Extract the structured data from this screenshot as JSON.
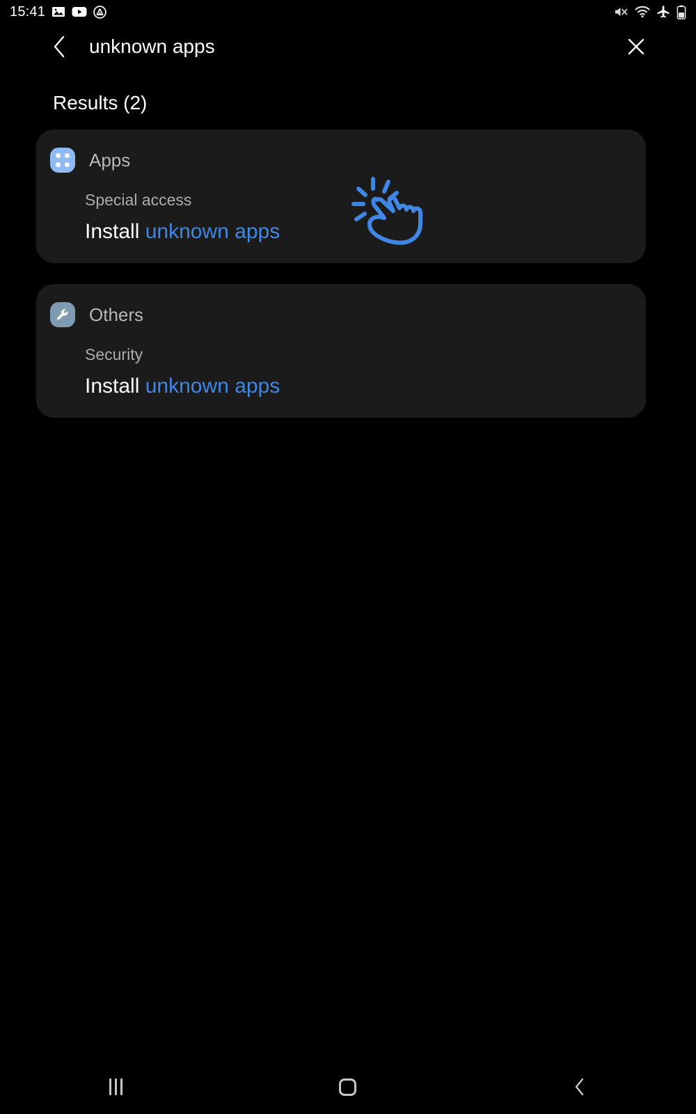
{
  "statusbar": {
    "time": "15:41",
    "left_icons": [
      "image-icon",
      "youtube-icon",
      "drive-triangle-icon"
    ],
    "right_icons": [
      "mute-icon",
      "wifi-icon",
      "airplane-mode-icon",
      "battery-icon"
    ]
  },
  "header": {
    "back_icon": "chevron-left-icon",
    "query": "unknown apps",
    "clear_icon": "close-icon"
  },
  "results": {
    "title": "Results (2)",
    "count": 2,
    "cards": [
      {
        "category": "Apps",
        "category_icon": "apps-grid-icon",
        "icon_color": "#8fbaf5",
        "sub_label": "Special access",
        "main_prefix": "Install",
        "main_highlight": "unknown apps",
        "cursor_icon": "tap-hand-icon"
      },
      {
        "category": "Others",
        "category_icon": "wrench-icon",
        "icon_color": "#7e9bb2",
        "sub_label": "Security",
        "main_prefix": "Install",
        "main_highlight": "unknown apps"
      }
    ]
  },
  "navbar": {
    "recents_label": "recents-icon",
    "home_label": "home-icon",
    "back_label": "back-icon"
  },
  "colors": {
    "background": "#000000",
    "card": "#1b1b1b",
    "highlight_blue": "#3f87e5",
    "secondary_text": "#adadad",
    "primary_text": "#ffffff"
  }
}
